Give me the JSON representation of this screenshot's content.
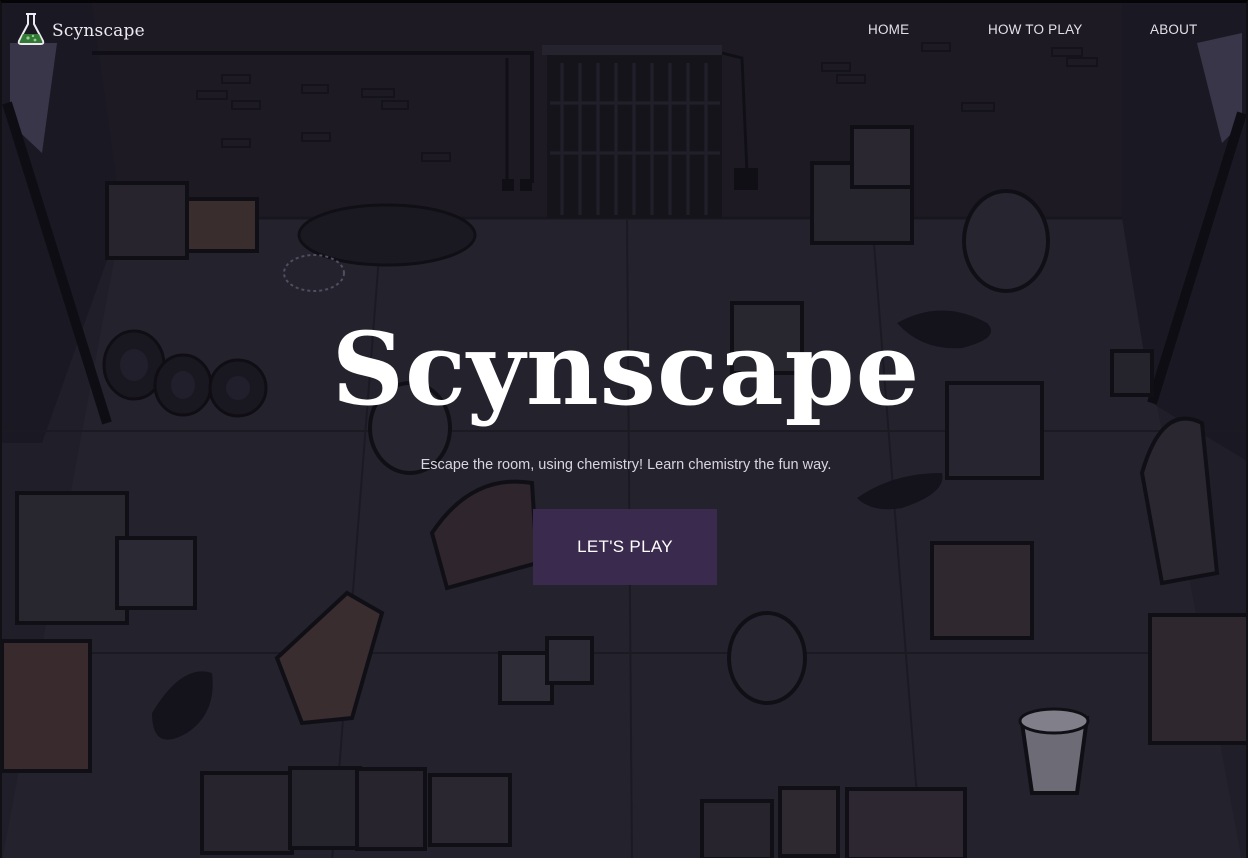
{
  "nav": {
    "brand": {
      "label": "Scynscape",
      "icon": "flask-icon"
    },
    "links": [
      {
        "label": "HOME"
      },
      {
        "label": "HOW TO PLAY"
      },
      {
        "label": "ABOUT"
      }
    ]
  },
  "hero": {
    "title": "Scynscape",
    "subtitle": "Escape the room, using chemistry! Learn chemistry the fun way.",
    "cta_label": "LET'S PLAY"
  },
  "colors": {
    "background": "#1e1c26",
    "button_bg": "#3a2a4d",
    "text": "#ffffff",
    "flask_liquid": "#3a8a3a"
  }
}
